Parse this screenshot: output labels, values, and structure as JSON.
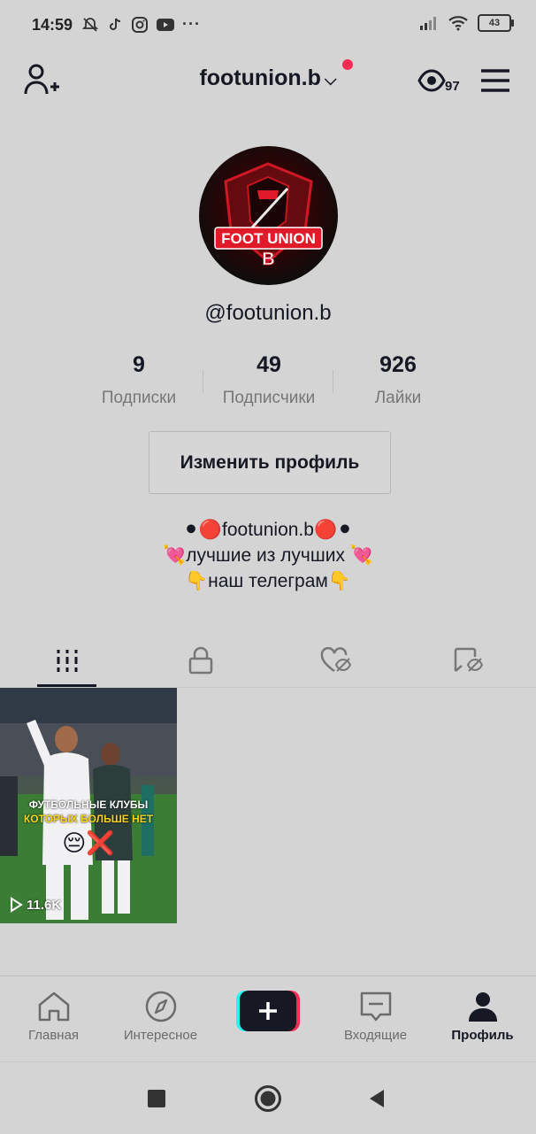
{
  "status_bar": {
    "time": "14:59",
    "battery": "43"
  },
  "header": {
    "username": "footunion.b",
    "views_count": "97"
  },
  "profile": {
    "avatar_text_line1": "FOOT UNION",
    "avatar_text_line2": "B",
    "handle": "@footunion.b",
    "stats": [
      {
        "value": "9",
        "label": "Подписки"
      },
      {
        "value": "49",
        "label": "Подписчики"
      },
      {
        "value": "926",
        "label": "Лайки"
      }
    ],
    "edit_button": "Изменить профиль",
    "bio": [
      "⚫🔴footunion.b🔴⚫",
      "💘лучшие из лучших 💘",
      "👇наш телеграм👇"
    ]
  },
  "tabs": [
    {
      "name": "videos-grid",
      "icon": "grid-icon",
      "active": true
    },
    {
      "name": "private",
      "icon": "lock-icon",
      "active": false
    },
    {
      "name": "liked-hidden",
      "icon": "heart-hidden-icon",
      "active": false
    },
    {
      "name": "saved-hidden",
      "icon": "bookmark-hidden-icon",
      "active": false
    }
  ],
  "videos": [
    {
      "caption_line1": "ФУТБОЛЬНЫЕ КЛУБЫ",
      "caption_line2": "КОТОРЫХ БОЛЬШЕ НЕТ",
      "emoji": "😔❌",
      "views": "11.6K"
    }
  ],
  "bottom_nav": [
    {
      "label": "Главная",
      "icon": "home-icon"
    },
    {
      "label": "Интересное",
      "icon": "compass-icon"
    },
    {
      "label": "",
      "icon": "plus-icon"
    },
    {
      "label": "Входящие",
      "icon": "inbox-icon"
    },
    {
      "label": "Профиль",
      "icon": "profile-icon",
      "active": true
    }
  ],
  "colors": {
    "accent": "#fe2c55",
    "cyan": "#25f4ee",
    "text": "#161823",
    "muted": "#777777",
    "background": "#d4d4d4"
  }
}
